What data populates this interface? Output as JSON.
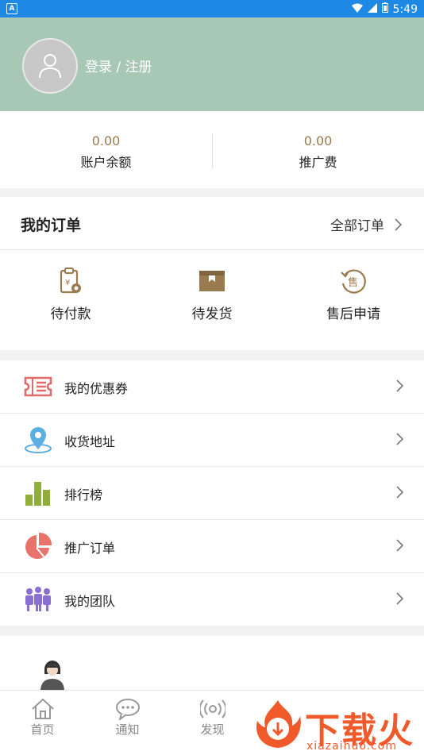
{
  "status_bar": {
    "time": "5:49"
  },
  "header": {
    "login_text": "登录 / 注册"
  },
  "balance": {
    "account": {
      "value": "0.00",
      "label": "账户余额"
    },
    "promotion": {
      "value": "0.00",
      "label": "推广费"
    }
  },
  "orders": {
    "title": "我的订单",
    "all_label": "全部订单",
    "items": [
      {
        "label": "待付款",
        "icon": "clipboard-yen-icon"
      },
      {
        "label": "待发货",
        "icon": "box-icon"
      },
      {
        "label": "售后申请",
        "icon": "after-sale-icon"
      }
    ]
  },
  "menu": [
    {
      "label": "我的优惠券",
      "icon": "coupon-icon",
      "color": "#e06b6b"
    },
    {
      "label": "收货地址",
      "icon": "location-pin-icon",
      "color": "#5aaee0"
    },
    {
      "label": "排行榜",
      "icon": "bar-chart-icon",
      "color": "#8fae3a"
    },
    {
      "label": "推广订单",
      "icon": "pie-chart-icon",
      "color": "#e8736a"
    },
    {
      "label": "我的团队",
      "icon": "team-icon",
      "color": "#8a6fd1"
    }
  ],
  "tabs": [
    {
      "label": "首页",
      "icon": "home-icon"
    },
    {
      "label": "通知",
      "icon": "chat-icon"
    },
    {
      "label": "发现",
      "icon": "broadcast-icon"
    }
  ],
  "watermark": {
    "text": "下载火",
    "url_text": "xiazaihuo.com"
  },
  "colors": {
    "header_bg": "#a7c8b4",
    "accent_brown": "#9a7b4f",
    "status_bar": "#1e88e5"
  }
}
